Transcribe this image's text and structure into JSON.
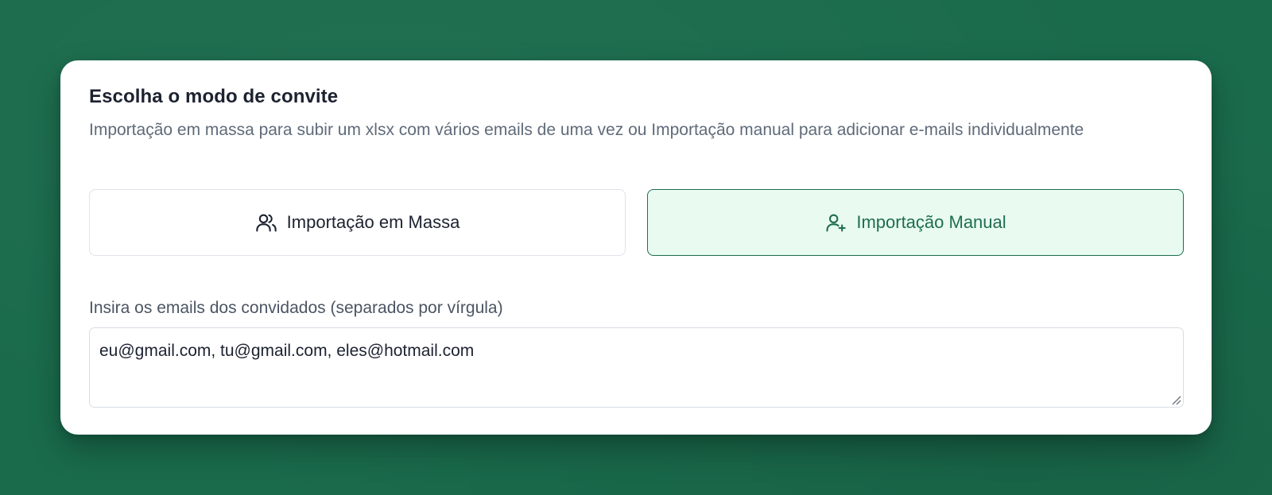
{
  "card": {
    "title": "Escolha o modo de convite",
    "subtitle": "Importação em massa para subir um xlsx com vários emails de uma vez ou Importação manual para adicionar e-mails individualmente"
  },
  "modes": {
    "bulk": {
      "label": "Importação em Massa",
      "icon": "users-icon",
      "selected": false
    },
    "manual": {
      "label": "Importação Manual",
      "icon": "user-plus-icon",
      "selected": true
    }
  },
  "emails_field": {
    "label": "Insira os emails dos convidados (separados por vírgula)",
    "value": "eu@gmail.com, tu@gmail.com, eles@hotmail.com"
  },
  "colors": {
    "background": "#1a6b4c",
    "accent": "#1f6e50",
    "accent_bg": "#e9fbf1",
    "text_primary": "#1c2230",
    "text_muted": "#5f6b7a"
  }
}
